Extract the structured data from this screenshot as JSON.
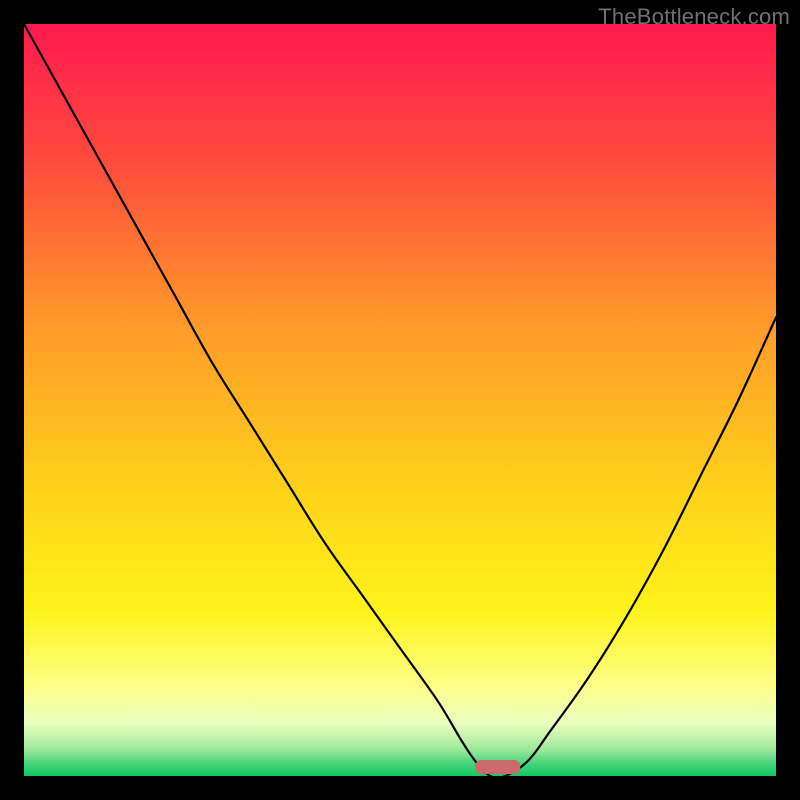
{
  "watermark": "TheBottleneck.com",
  "chart_data": {
    "type": "line",
    "title": "",
    "xlabel": "",
    "ylabel": "",
    "xlim": [
      0,
      100
    ],
    "ylim": [
      0,
      100
    ],
    "grid": false,
    "legend": false,
    "series": [
      {
        "name": "bottleneck-curve",
        "x": [
          0,
          5,
          10,
          15,
          20,
          25,
          30,
          35,
          40,
          45,
          50,
          55,
          58,
          60,
          62,
          64,
          67,
          70,
          75,
          80,
          85,
          90,
          95,
          100
        ],
        "y": [
          100,
          91,
          82,
          73,
          64,
          55,
          47,
          39,
          31,
          24,
          17,
          10,
          5,
          2,
          0,
          0,
          2,
          6,
          13,
          21,
          30,
          40,
          50,
          61
        ]
      }
    ],
    "marker_band": {
      "x_start": 60,
      "x_end": 66,
      "color": "#c96a6d"
    },
    "gradient_stops": [
      {
        "pct": 0,
        "color": "#ff1a50"
      },
      {
        "pct": 18,
        "color": "#ff4a3c"
      },
      {
        "pct": 40,
        "color": "#ff9a2a"
      },
      {
        "pct": 62,
        "color": "#ffd21a"
      },
      {
        "pct": 78,
        "color": "#fff31a"
      },
      {
        "pct": 88,
        "color": "#ffff88"
      },
      {
        "pct": 93,
        "color": "#eaffc0"
      },
      {
        "pct": 96.5,
        "color": "#9be89a"
      },
      {
        "pct": 98.5,
        "color": "#40d37a"
      },
      {
        "pct": 100,
        "color": "#12c95f"
      }
    ]
  }
}
